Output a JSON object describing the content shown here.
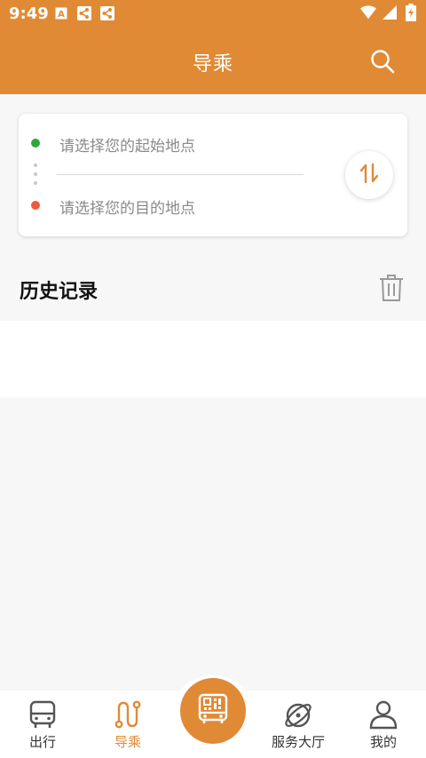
{
  "status_bar": {
    "time": "9:49",
    "left_icons": [
      "a-badge-icon",
      "share-icon",
      "share-icon"
    ],
    "right_icons": [
      "wifi-icon",
      "signal-icon",
      "battery-icon"
    ]
  },
  "app_bar": {
    "title": "导乘",
    "search_icon": "search-icon",
    "color": "#e08a36"
  },
  "route": {
    "start_placeholder": "请选择您的起始地点",
    "end_placeholder": "请选择您的目的地点",
    "start_color": "#2ea83a",
    "end_color": "#ef5a3c",
    "swap_icon": "swap-vertical-icon"
  },
  "history": {
    "title": "历史记录",
    "clear_icon": "trash-icon"
  },
  "bottom_nav": {
    "items": [
      {
        "label": "出行",
        "icon": "bus-icon",
        "active": false
      },
      {
        "label": "导乘",
        "icon": "route-icon",
        "active": true
      },
      {
        "label": "服务大厅",
        "icon": "planet-icon",
        "active": false
      },
      {
        "label": "我的",
        "icon": "person-icon",
        "active": false
      }
    ],
    "center_icon": "qr-bus-icon",
    "active_color": "#e08a36"
  }
}
